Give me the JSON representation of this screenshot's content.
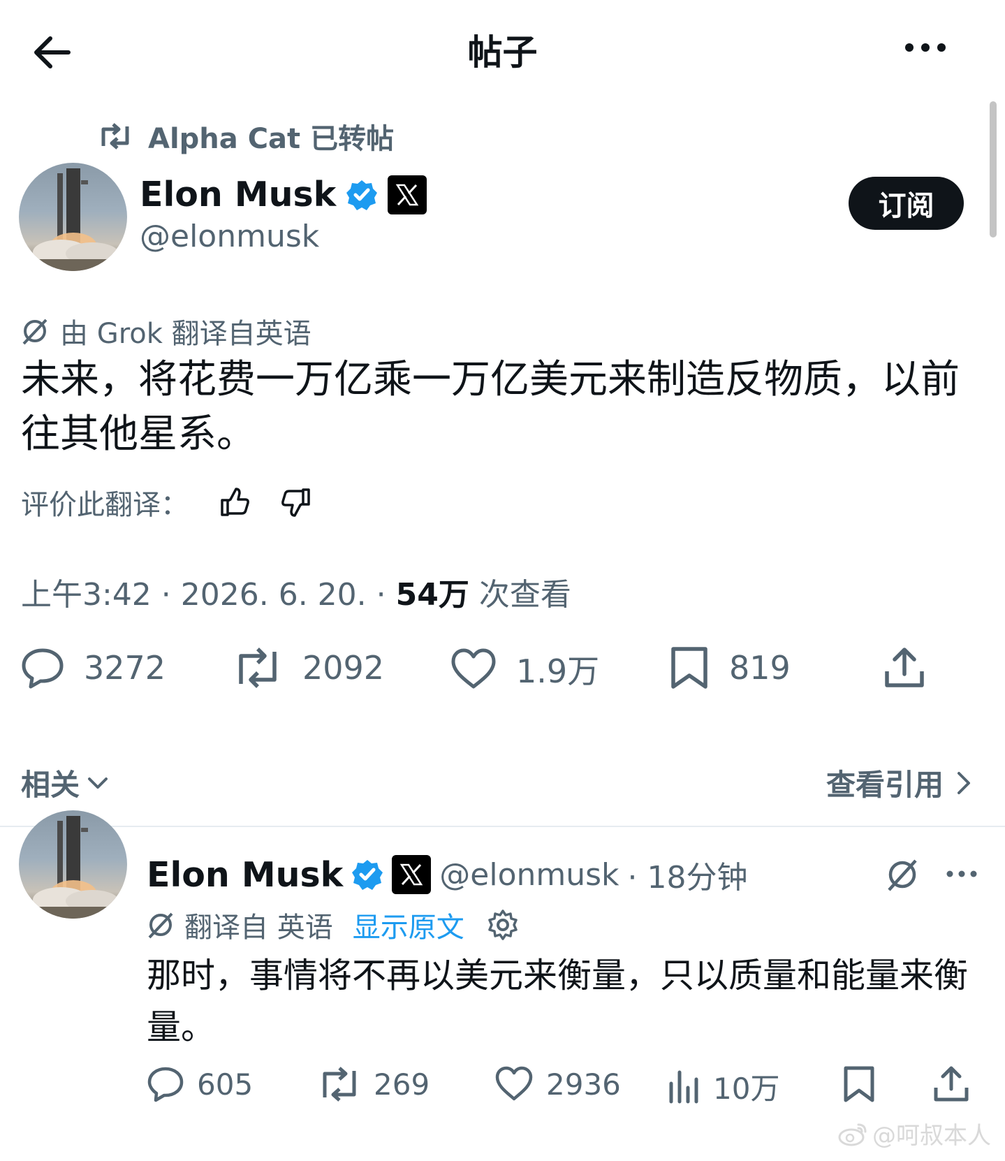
{
  "header": {
    "title": "帖子"
  },
  "repost": {
    "label": "Alpha Cat 已转帖"
  },
  "post": {
    "author": {
      "name": "Elon Musk",
      "handle": "@elonmusk"
    },
    "subscribe_label": "订阅",
    "translation_note": "由 Grok 翻译自英语",
    "text": "未来，将花费一万亿乘一万亿美元来制造反物质，以前往其他星系。",
    "rate_label": "评价此翻译：",
    "time": "上午3:42 · 2026. 6. 20. · ",
    "views_count": "54万",
    "views_label": " 次查看",
    "stats": {
      "replies": "3272",
      "reposts": "2092",
      "likes": "1.9万",
      "bookmarks": "819"
    }
  },
  "related": {
    "label": "相关",
    "quotes_label": "查看引用"
  },
  "reply": {
    "author": {
      "name": "Elon Musk",
      "handle": "@elonmusk",
      "time": "· 18分钟"
    },
    "translated_from": "翻译自 英语",
    "show_original": "显示原文",
    "text": "那时，事情将不再以美元来衡量，只以质量和能量来衡量。",
    "stats": {
      "replies": "605",
      "reposts": "269",
      "likes": "2936",
      "views": "10万"
    }
  },
  "watermark": "@呵叔本人",
  "colors": {
    "link": "#1d9bf0",
    "verified": "#1d9bf0",
    "muted": "#536471",
    "text": "#0f1419"
  }
}
